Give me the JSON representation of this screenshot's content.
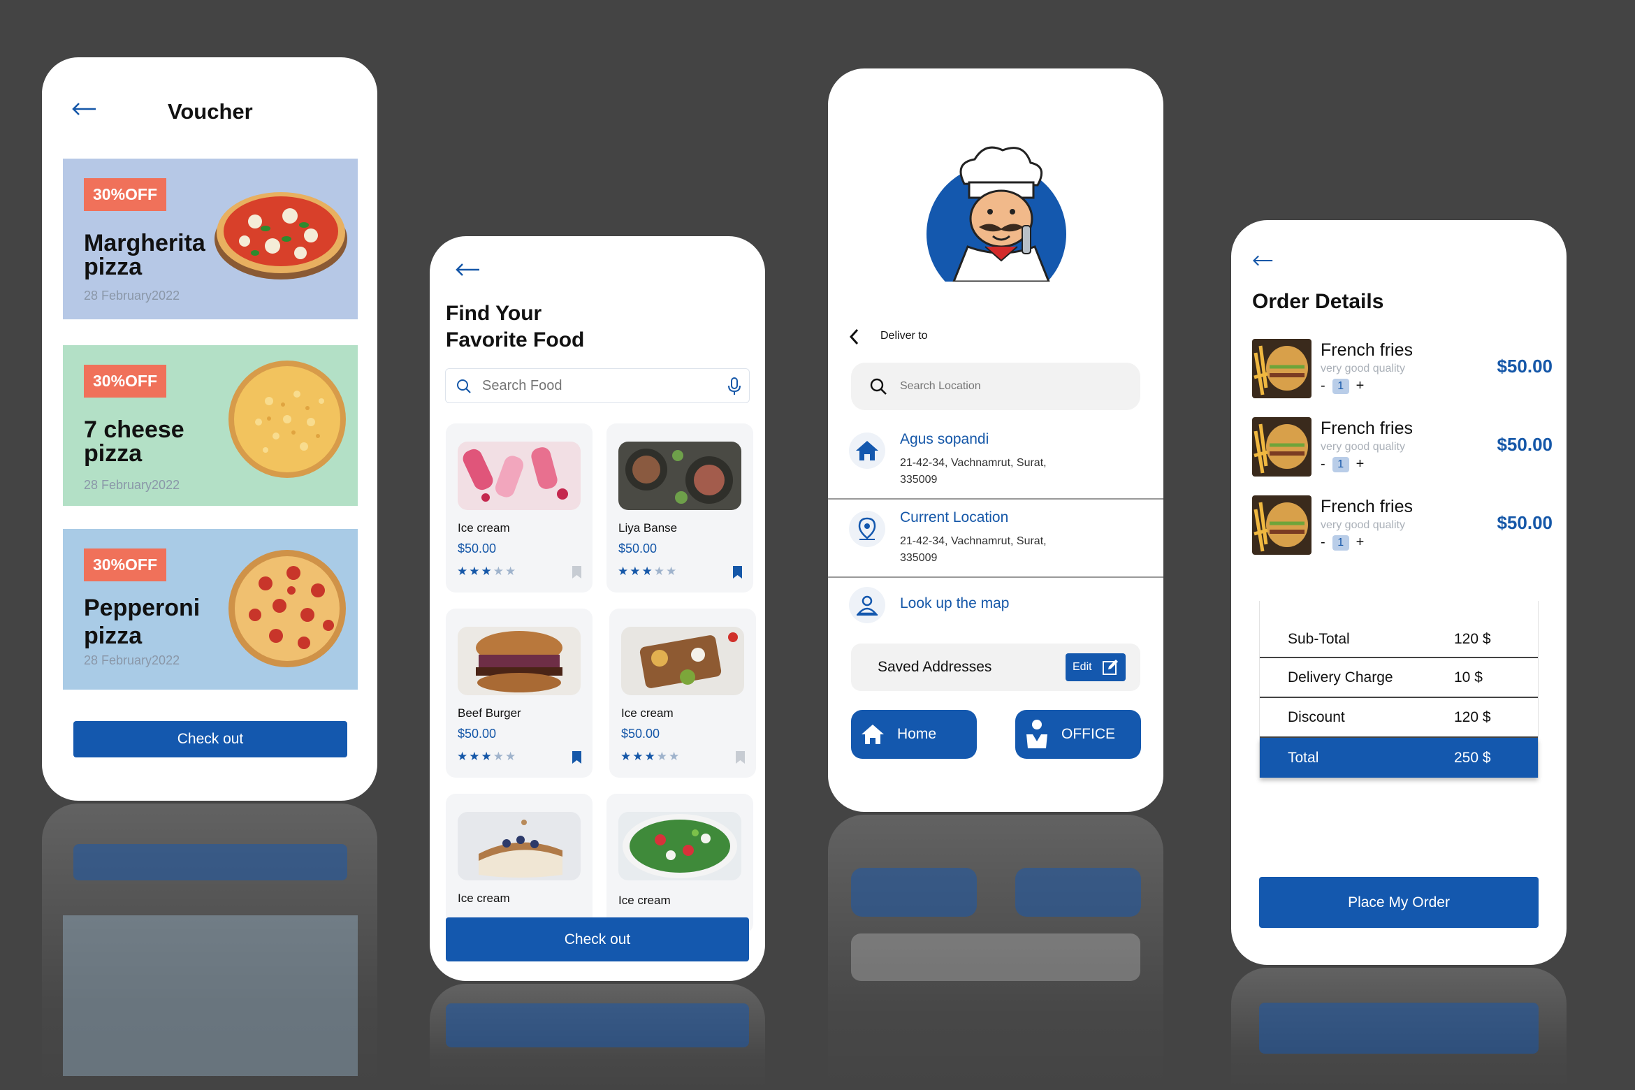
{
  "voucher": {
    "title": "Voucher",
    "cards": [
      {
        "badge": "30%OFF",
        "name_line1": "Margherita",
        "name_line2": "pizza",
        "date": "28 February2022",
        "bg": "#b6c8e6"
      },
      {
        "badge": "30%OFF",
        "name_line1": "7 cheese",
        "name_line2": "pizza",
        "date": "28 February2022",
        "bg": "#b3e0c6"
      },
      {
        "badge": "30%OFF",
        "name_line1": "Pepperoni",
        "name_line2": "pizza",
        "date": "28 February2022",
        "bg": "#a9cbe6"
      }
    ],
    "checkout_label": "Check out"
  },
  "find_food": {
    "title_line1": "Find Your",
    "title_line2": "Favorite Food",
    "search_placeholder": "Search Food",
    "items": [
      {
        "name": "Ice cream",
        "price": "$50.00",
        "rating": 3,
        "saved": false
      },
      {
        "name": "Liya Banse",
        "price": "$50.00",
        "rating": 3,
        "saved": true
      },
      {
        "name": "Beef Burger",
        "price": "$50.00",
        "rating": 3,
        "saved": true
      },
      {
        "name": "Ice cream",
        "price": "$50.00",
        "rating": 3,
        "saved": false
      },
      {
        "name": "Ice cream",
        "price": "",
        "rating": 0,
        "saved": false
      },
      {
        "name": "Ice cream",
        "price": "",
        "rating": 0,
        "saved": false
      }
    ],
    "checkout_label": "Check out"
  },
  "deliver": {
    "deliver_to_label": "Deliver to",
    "search_placeholder": "Search Location",
    "addresses": [
      {
        "title": "Agus sopandi",
        "line1": "21-42-34, Vachnamrut, Surat,",
        "line2": "335009"
      },
      {
        "title": "Current Location",
        "line1": "21-42-34, Vachnamrut, Surat,",
        "line2": "335009"
      }
    ],
    "map_label": "Look up the map",
    "saved_addresses_label": "Saved Addresses",
    "edit_label": "Edit",
    "home_label": "Home",
    "office_label": "OFFICE"
  },
  "order": {
    "title": "Order Details",
    "items": [
      {
        "name": "French fries",
        "quality": "very good quality",
        "minus": "-",
        "qty": "1",
        "plus": "+",
        "price": "$50.00"
      },
      {
        "name": "French fries",
        "quality": "very good quality",
        "minus": "-",
        "qty": "1",
        "plus": "+",
        "price": "$50.00"
      },
      {
        "name": "French fries",
        "quality": "very good quality",
        "minus": "-",
        "qty": "1",
        "plus": "+",
        "price": "$50.00"
      }
    ],
    "summary": [
      {
        "label": "Sub-Total",
        "value": "120 $"
      },
      {
        "label": "Delivery Charge",
        "value": "10 $"
      },
      {
        "label": "Discount",
        "value": "120 $"
      }
    ],
    "total_label": "Total",
    "total_value": "250 $",
    "place_order_label": "Place My Order"
  },
  "colors": {
    "primary": "#1458ae",
    "badge": "#f0715a",
    "background": "#444444"
  }
}
